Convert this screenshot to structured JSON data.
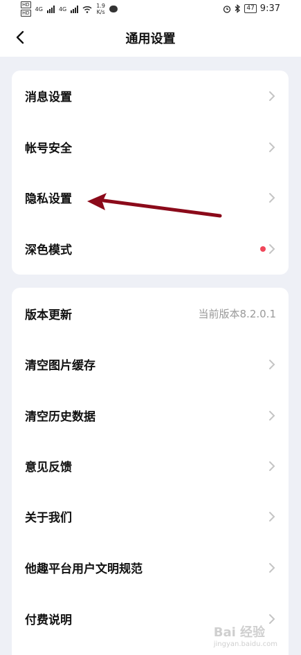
{
  "status_bar": {
    "hd1": "HD",
    "hd2": "HD",
    "net1": "4G",
    "net2": "4G",
    "speed_value": "1.9",
    "speed_unit": "K/s",
    "battery": "47",
    "time": "9:37"
  },
  "header": {
    "title": "通用设置"
  },
  "group1": [
    {
      "label": "消息设置"
    },
    {
      "label": "帐号安全"
    },
    {
      "label": "隐私设置"
    },
    {
      "label": "深色模式"
    }
  ],
  "group2": [
    {
      "label": "版本更新",
      "value": "当前版本8.2.0.1"
    },
    {
      "label": "清空图片缓存"
    },
    {
      "label": "清空历史数据"
    },
    {
      "label": "意见反馈"
    },
    {
      "label": "关于我们"
    },
    {
      "label": "他趣平台用户文明规范"
    },
    {
      "label": "付费说明"
    }
  ],
  "colors": {
    "badge_dot": "#f0465a",
    "annotation_arrow": "#8b0a1a",
    "background": "#eef0f6"
  },
  "watermark": {
    "brand": "Bai 经验",
    "url": "jingyan.baidu.com"
  }
}
